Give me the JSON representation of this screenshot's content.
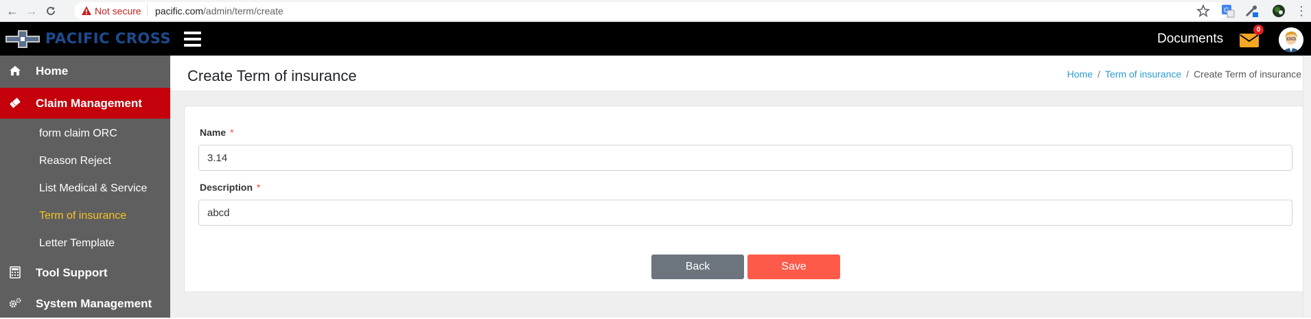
{
  "browser": {
    "security_label": "Not secure",
    "url_host": "pacific.com",
    "url_path": "/admin/term/create"
  },
  "topbar": {
    "brand": "PACIFIC CROSS",
    "documents_label": "Documents",
    "mail_badge_count": "0"
  },
  "sidebar": {
    "items": [
      {
        "label": "Home",
        "icon": "home-icon"
      },
      {
        "label": "Claim Management",
        "icon": "ticket-icon",
        "active": true
      },
      {
        "label": "form claim ORC"
      },
      {
        "label": "Reason Reject"
      },
      {
        "label": "List Medical & Service"
      },
      {
        "label": "Term of insurance",
        "current": true
      },
      {
        "label": "Letter Template"
      },
      {
        "label": "Tool Support",
        "icon": "calculator-icon"
      },
      {
        "label": "System Management",
        "icon": "cogs-icon"
      }
    ]
  },
  "page": {
    "title": "Create Term of insurance",
    "breadcrumb": [
      "Home",
      "Term of insurance",
      "Create Term of insurance"
    ]
  },
  "form": {
    "name_label": "Name",
    "name_value": "3.14",
    "description_label": "Description",
    "description_value": "abcd",
    "required_marker": "*",
    "back_label": "Back",
    "save_label": "Save"
  },
  "colors": {
    "active_menu": "#c4000b",
    "current_submenu": "#f7c325",
    "save_button": "#fd5a4a",
    "back_button": "#6c757d",
    "link": "#2b9bd1"
  }
}
